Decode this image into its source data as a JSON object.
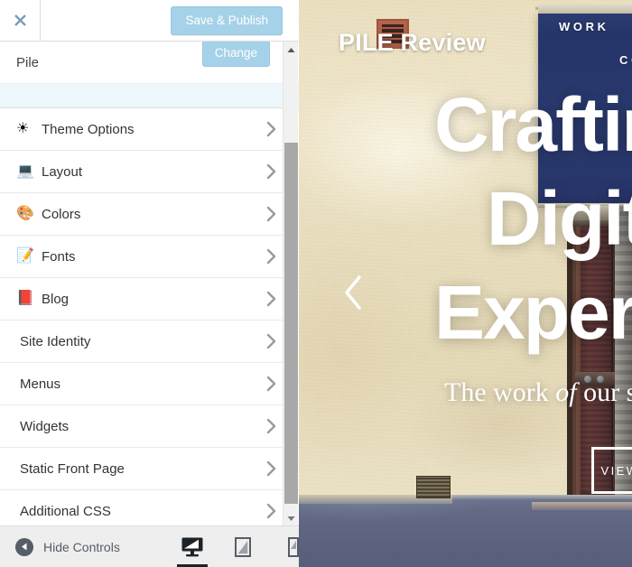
{
  "customizer": {
    "close_icon": "close-x-icon",
    "save_label": "Save & Publish",
    "site_name": "Pile",
    "change_label": "Change",
    "menu_items": [
      {
        "icon": "☀",
        "icon_name": "sun-icon",
        "label": "Theme Options",
        "has_icon": true
      },
      {
        "icon": "💻",
        "icon_name": "laptop-icon",
        "label": "Layout",
        "has_icon": true
      },
      {
        "icon": "🎨",
        "icon_name": "palette-icon",
        "label": "Colors",
        "has_icon": true
      },
      {
        "icon": "📝",
        "icon_name": "memo-icon",
        "label": "Fonts",
        "has_icon": true
      },
      {
        "icon": "📕",
        "icon_name": "book-icon",
        "label": "Blog",
        "has_icon": true
      },
      {
        "icon": "",
        "icon_name": "",
        "label": "Site Identity",
        "has_icon": false
      },
      {
        "icon": "",
        "icon_name": "",
        "label": "Menus",
        "has_icon": false
      },
      {
        "icon": "",
        "icon_name": "",
        "label": "Widgets",
        "has_icon": false
      },
      {
        "icon": "",
        "icon_name": "",
        "label": "Static Front Page",
        "has_icon": false
      },
      {
        "icon": "",
        "icon_name": "",
        "label": "Additional CSS",
        "has_icon": false
      }
    ],
    "bottom_bar": {
      "hide_controls_label": "Hide Controls",
      "devices": [
        {
          "name": "desktop",
          "active": true
        },
        {
          "name": "tablet",
          "active": false
        },
        {
          "name": "mobile",
          "active": false
        }
      ]
    },
    "colors": {
      "accent_button": "#a5d2e8",
      "panel_bg": "#eeeeee",
      "highlight_strip": "#eef7fb",
      "text": "#333333",
      "device_active": "#1d2327"
    }
  },
  "preview": {
    "site_title": "PILE Review",
    "nav": [
      {
        "label": "WORK"
      },
      {
        "label": "CONTACT"
      }
    ],
    "hero": {
      "line1": "Crafting",
      "line2": "Digital",
      "line3": "Experiences",
      "subtitle_pre": "The work ",
      "subtitle_em": "of ",
      "subtitle_post": "our studio",
      "button_label": "VIEW WORK"
    },
    "slider_prev_icon": "chevron-left-icon"
  }
}
